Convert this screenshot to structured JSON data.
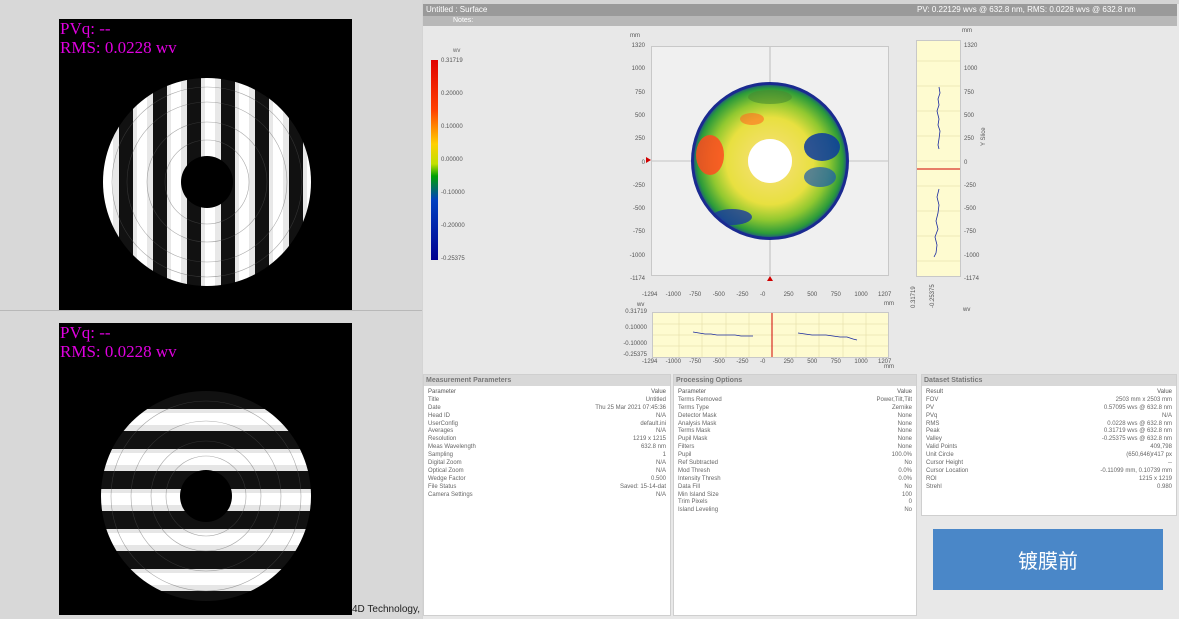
{
  "left": {
    "top_image": {
      "pv": "PVq: --",
      "rms": "RMS: 0.0228 wv"
    },
    "bottom_image": {
      "pv": "PVq: --",
      "rms": "RMS: 0.0228 wv"
    },
    "vendor": "4D Technology,"
  },
  "window": {
    "title": "Untitled : Surface",
    "summary": "PV: 0.22129 wvs @ 632.8 nm, RMS: 0.0228 wvs @ 632.8 nm",
    "notes_label": "Notes:"
  },
  "colorbar": {
    "unit": "wv",
    "labels": [
      "0.31719",
      "0.20000",
      "0.10000",
      "0.00000",
      "-0.10000",
      "-0.20000",
      "-0.25375"
    ]
  },
  "surface_map": {
    "y_unit": "mm",
    "x_unit": "mm",
    "y_ticks": [
      "1320",
      "1000",
      "750",
      "500",
      "250",
      "0",
      "-250",
      "-500",
      "-750",
      "-1000",
      "-1174"
    ],
    "x_ticks": [
      "-1294",
      "-1000",
      "-750",
      "-500",
      "-250",
      "-0",
      "250",
      "500",
      "750",
      "1000",
      "1207"
    ]
  },
  "y_profile": {
    "unit_top": "mm",
    "axis_label": "Y Slice",
    "y_ticks": [
      "1320",
      "1000",
      "750",
      "500",
      "250",
      "0",
      "-250",
      "-500",
      "-750",
      "-1000",
      "-1174"
    ],
    "x_ticks": [
      "0.31719",
      "-0.25375"
    ],
    "x_unit": "wv"
  },
  "x_profile": {
    "unit": "wv",
    "y_ticks": [
      "0.31719",
      "0.10000",
      "-0.10000",
      "-0.25375"
    ],
    "x_ticks": [
      "-1294",
      "-1000",
      "-750",
      "-500",
      "-250",
      "-0",
      "250",
      "500",
      "750",
      "1000",
      "1207"
    ],
    "x_unit": "mm"
  },
  "measurement_parameters": {
    "title": "Measurement Parameters",
    "header": [
      "Parameter",
      "Value"
    ],
    "rows": [
      [
        "Title",
        "Untitled"
      ],
      [
        "Date",
        "Thu 25 Mar 2021 07:45:36"
      ],
      [
        "Head ID",
        "N/A"
      ],
      [
        "UserConfig",
        "default.ini"
      ],
      [
        "Averages",
        "N/A"
      ],
      [
        "Resolution",
        "1219 x 1215"
      ],
      [
        "Meas Wavelength",
        "632.8 nm"
      ],
      [
        "Sampling",
        "1"
      ],
      [
        "Digital Zoom",
        "N/A"
      ],
      [
        "Optical Zoom",
        "N/A"
      ],
      [
        "Wedge Factor",
        "0.500"
      ],
      [
        "File Status",
        "Saved: 15-14-dat"
      ],
      [
        "Camera Settings",
        "N/A"
      ]
    ]
  },
  "processing_options": {
    "title": "Processing Options",
    "header": [
      "Parameter",
      "Value"
    ],
    "rows": [
      [
        "Terms Removed",
        "Power,Tilt,Tilt"
      ],
      [
        "Terms Type",
        "Zernike"
      ],
      [
        "Detector Mask",
        "None"
      ],
      [
        "Analysis Mask",
        "None"
      ],
      [
        "Terms Mask",
        "None"
      ],
      [
        "Pupil Mask",
        "None"
      ],
      [
        "Filters",
        "None"
      ],
      [
        "Pupil",
        "100.0%"
      ],
      [
        "Ref Subtracted",
        "No"
      ],
      [
        "Mod Thresh",
        "0.0%"
      ],
      [
        "Intensity Thresh",
        "0.0%"
      ],
      [
        "Data Fill",
        "No"
      ],
      [
        "Min Island Size",
        "100"
      ],
      [
        "Trim Pixels",
        "0"
      ],
      [
        "Island Leveling",
        "No"
      ]
    ]
  },
  "dataset_statistics": {
    "title": "Dataset Statistics",
    "header": [
      "Result",
      "Value"
    ],
    "rows": [
      [
        "FOV",
        "2503 mm x 2503 mm"
      ],
      [
        "PV",
        "0.57095 wvs @ 632.8 nm"
      ],
      [
        "PVq",
        "N/A"
      ],
      [
        "RMS",
        "0.0228 wvs @ 632.8 nm"
      ],
      [
        "Peak",
        "0.31719 wvs @ 632.8 nm"
      ],
      [
        "Valley",
        "-0.25375 wvs @ 632.8 nm"
      ],
      [
        "Valid Points",
        "409,798"
      ],
      [
        "Unit Circle",
        "(650,646)r417 px"
      ],
      [
        "Cursor Height",
        "--"
      ],
      [
        "Cursor Location",
        "-0.11099 mm, 0.10739 mm"
      ],
      [
        "ROI",
        "1215 x 1219"
      ],
      [
        "Strehl",
        "0.980"
      ]
    ]
  },
  "badge": {
    "label": "镀膜前"
  },
  "colors": {
    "fringe_text": "#e000e0",
    "badge": "#4a87c8",
    "profile_bg": "#fefbd0",
    "profile_line": "#1a2aa0"
  }
}
